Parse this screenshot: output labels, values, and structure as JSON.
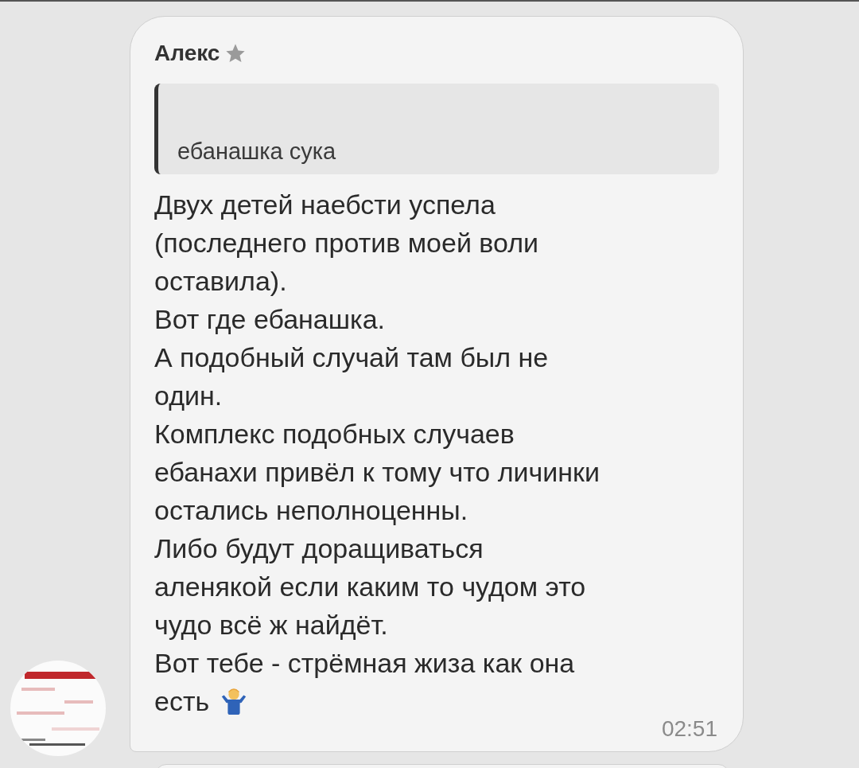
{
  "message": {
    "sender": "Алекс",
    "quote": {
      "text": "ебанашка сука"
    },
    "lines": [
      "Двух детей наебсти успела",
      "(последнего против моей воли",
      "оставила).",
      "Вот где ебанашка.",
      "А подобный случай там был не",
      "один.",
      "Комплекс подобных случаев",
      "ебанахи привёл к тому что личинки",
      "остались неполноценны.",
      "Либо будут доращиваться",
      "аленякой если каким то чудом это",
      "чудо всё ж найдёт.",
      "Вот тебе - стрёмная жиза как она",
      "есть"
    ],
    "time": "02:51"
  }
}
